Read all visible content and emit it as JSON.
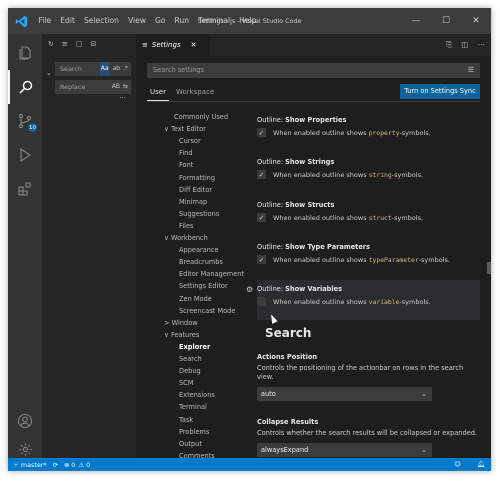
{
  "window": {
    "title": "Settings - js - Visual Studio Code",
    "menu": [
      "File",
      "Edit",
      "Selection",
      "View",
      "Go",
      "Run",
      "Terminal",
      "Help"
    ],
    "controls": {
      "minimize": "—",
      "maximize": "☐",
      "close": "✕"
    }
  },
  "sidebar": {
    "search_placeholder": "Search",
    "replace_placeholder": "Replace",
    "search_opts": [
      "Aa",
      "ab",
      ".*"
    ],
    "replace_opt": "AB",
    "more": "..."
  },
  "editor": {
    "tab_label": "Settings",
    "tab_close": "✕"
  },
  "settings": {
    "search_placeholder": "Search settings",
    "scope_user": "User",
    "scope_workspace": "Workspace",
    "sync_button": "Turn on Settings Sync",
    "toc": [
      {
        "label": "Commonly Used",
        "indent": 0
      },
      {
        "label": "Text Editor",
        "indent": 0,
        "chev": "∨"
      },
      {
        "label": "Cursor",
        "indent": 1
      },
      {
        "label": "Find",
        "indent": 1
      },
      {
        "label": "Font",
        "indent": 1
      },
      {
        "label": "Formatting",
        "indent": 1
      },
      {
        "label": "Diff Editor",
        "indent": 1
      },
      {
        "label": "Minimap",
        "indent": 1
      },
      {
        "label": "Suggestions",
        "indent": 1
      },
      {
        "label": "Files",
        "indent": 1
      },
      {
        "label": "Workbench",
        "indent": 0,
        "chev": "∨"
      },
      {
        "label": "Appearance",
        "indent": 1
      },
      {
        "label": "Breadcrumbs",
        "indent": 1
      },
      {
        "label": "Editor Management",
        "indent": 1
      },
      {
        "label": "Settings Editor",
        "indent": 1
      },
      {
        "label": "Zen Mode",
        "indent": 1
      },
      {
        "label": "Screencast Mode",
        "indent": 1
      },
      {
        "label": "Window",
        "indent": 0,
        "chev": ">"
      },
      {
        "label": "Features",
        "indent": 0,
        "chev": "∨"
      },
      {
        "label": "Explorer",
        "indent": 1,
        "bold": true
      },
      {
        "label": "Search",
        "indent": 1
      },
      {
        "label": "Debug",
        "indent": 1
      },
      {
        "label": "SCM",
        "indent": 1
      },
      {
        "label": "Extensions",
        "indent": 1
      },
      {
        "label": "Terminal",
        "indent": 1
      },
      {
        "label": "Task",
        "indent": 1
      },
      {
        "label": "Problems",
        "indent": 1
      },
      {
        "label": "Output",
        "indent": 1
      },
      {
        "label": "Comments",
        "indent": 1
      }
    ],
    "outline_items": [
      {
        "prefix": "Outline: ",
        "name": "Show Properties",
        "pre": "When enabled outline shows ",
        "code": "property",
        "post": "-symbols.",
        "checked": true
      },
      {
        "prefix": "Outline: ",
        "name": "Show Strings",
        "pre": "When enabled outline shows ",
        "code": "string",
        "post": "-symbols.",
        "checked": true
      },
      {
        "prefix": "Outline: ",
        "name": "Show Structs",
        "pre": "When enabled outline shows ",
        "code": "struct",
        "post": "-symbols.",
        "checked": true
      },
      {
        "prefix": "Outline: ",
        "name": "Show Type Parameters",
        "pre": "When enabled outline shows ",
        "code": "typeParameter",
        "post": "-symbols.",
        "checked": true
      },
      {
        "prefix": "Outline: ",
        "name": "Show Variables",
        "pre": "When enabled outline shows ",
        "code": "variable",
        "post": "-symbols.",
        "checked": false
      }
    ],
    "search_section": {
      "heading": "Search",
      "actions_title": "Actions Position",
      "actions_desc": "Controls the positioning of the actionbar on rows in the search view.",
      "actions_value": "auto",
      "collapse_title": "Collapse Results",
      "collapse_desc": "Controls whether the search results will be collapsed or expanded.",
      "collapse_value": "alwaysExpand"
    }
  },
  "statusbar": {
    "branch": "master*",
    "errors": "0",
    "warnings": "0"
  },
  "colors": {
    "accent": "#007acc",
    "button": "#0e639c",
    "code": "#d7ba7d"
  }
}
